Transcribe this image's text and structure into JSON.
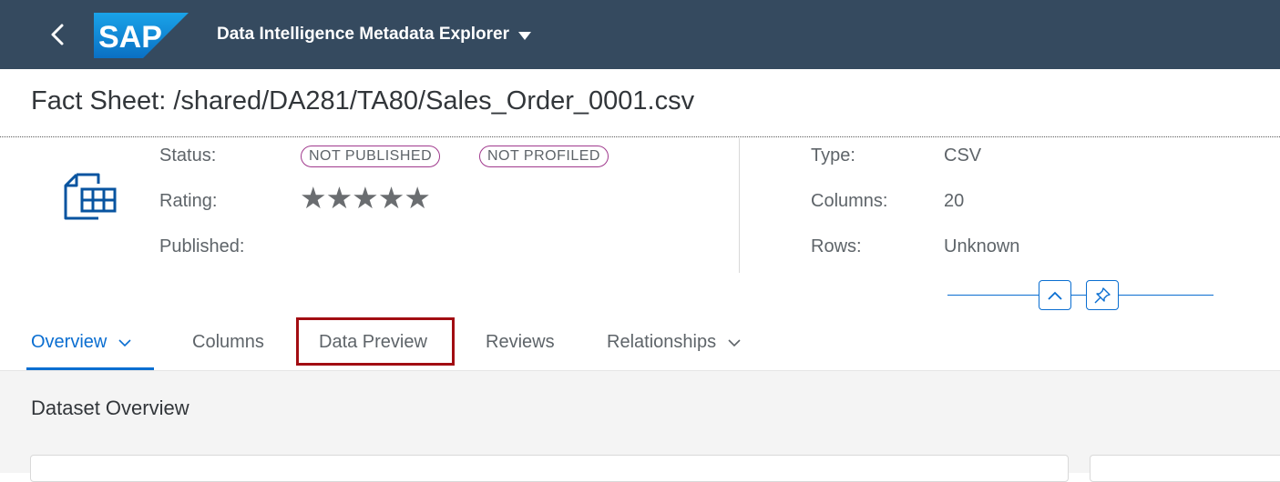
{
  "shell": {
    "back_icon": "chevron-left-icon",
    "logo_text": "SAP",
    "app_title": "Data Intelligence Metadata Explorer",
    "title_caret_icon": "caret-down-icon"
  },
  "page": {
    "title": "Fact Sheet: /shared/DA281/TA80/Sales_Order_0001.csv"
  },
  "header": {
    "icon": "csv-table-file-icon",
    "status_label": "Status:",
    "badges": [
      "NOT PUBLISHED",
      "NOT PROFILED"
    ],
    "rating_label": "Rating:",
    "rating_stars": "★★★★★",
    "rating_value": 0,
    "published_label": "Published:",
    "published_value": "",
    "type_label": "Type:",
    "type_value": "CSV",
    "columns_label": "Columns:",
    "columns_value": "20",
    "rows_label": "Rows:",
    "rows_value": "Unknown",
    "collapse_icon": "chevron-up-icon",
    "pin_icon": "pin-icon"
  },
  "tabs": [
    {
      "label": "Overview",
      "selected": true,
      "has_menu": true
    },
    {
      "label": "Columns",
      "selected": false,
      "has_menu": false
    },
    {
      "label": "Data Preview",
      "selected": false,
      "has_menu": false,
      "highlighted": true
    },
    {
      "label": "Reviews",
      "selected": false,
      "has_menu": false
    },
    {
      "label": "Relationships",
      "selected": false,
      "has_menu": true
    }
  ],
  "content": {
    "section_title": "Dataset Overview"
  },
  "colors": {
    "shell_bg": "#354a5f",
    "accent": "#0a6ed1",
    "badge_border": "#a0398d",
    "highlight": "#a20d12"
  }
}
